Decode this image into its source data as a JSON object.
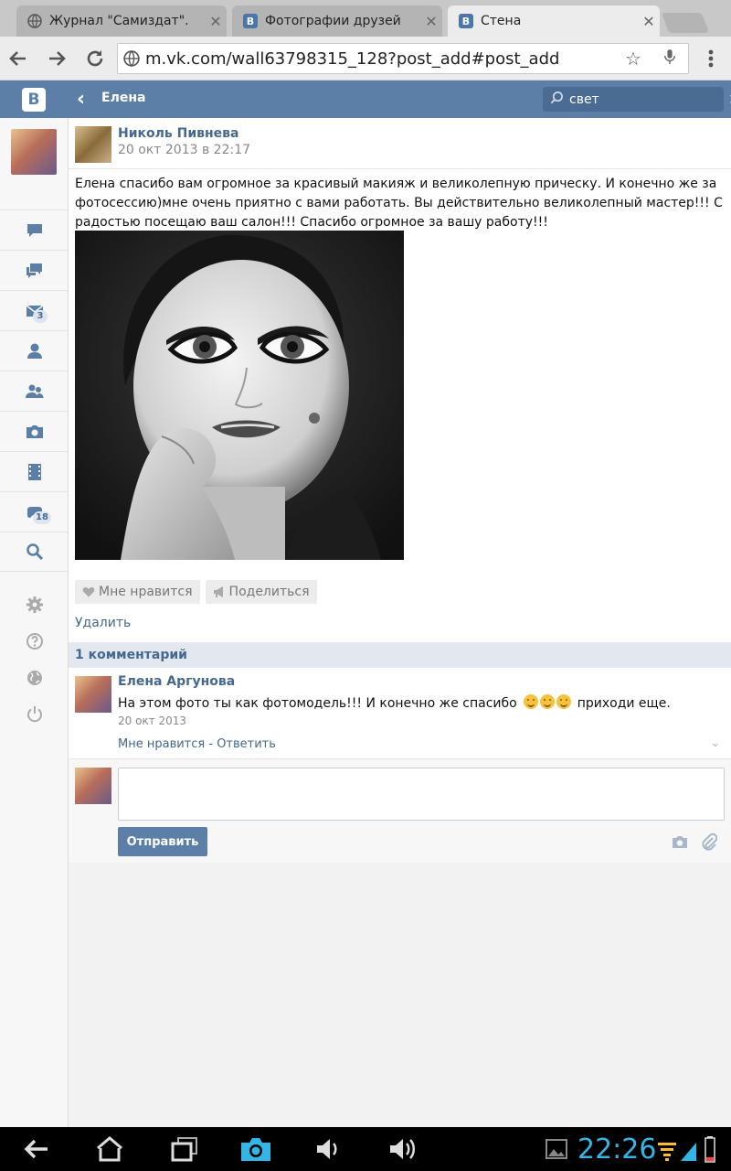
{
  "browser": {
    "tabs": [
      {
        "title": "Журнал \"Самиздат\".",
        "close": "✕",
        "favicon": "globe-icon",
        "active": false
      },
      {
        "title": "Фотографии друзей",
        "close": "✕",
        "favicon": "vk-icon",
        "active": false
      },
      {
        "title": "Стена",
        "close": "✕",
        "favicon": "vk-icon",
        "active": true
      }
    ],
    "url": "m.vk.com/wall63798315_128?post_add#post_add"
  },
  "header": {
    "logo": "B",
    "title": "Елена",
    "search_value": "свет"
  },
  "sidebar": {
    "items": [
      {
        "name": "news-icon"
      },
      {
        "name": "comments-icon"
      },
      {
        "name": "messages-icon",
        "badge": "3"
      },
      {
        "name": "friends-icon"
      },
      {
        "name": "groups-icon"
      },
      {
        "name": "photos-icon"
      },
      {
        "name": "videos-icon"
      },
      {
        "name": "games-icon",
        "badge": "18"
      },
      {
        "name": "search-icon"
      }
    ],
    "subitems": [
      {
        "name": "settings-icon"
      },
      {
        "name": "help-icon"
      },
      {
        "name": "language-icon"
      },
      {
        "name": "logout-icon"
      }
    ]
  },
  "post": {
    "author": "Николь Пивнева",
    "date": "20 окт 2013 в 22:17",
    "text": "Елена спасибо вам огромное за красивый макияж и великолепную прическу. И конечно же за фотосессию)мне очень приятно с вами работать. Вы действительно великолепный мастер!!! С радостью посещаю ваш салон!!! Спасибо огромное за вашу работу!!!",
    "like_label": "Мне нравится",
    "share_label": "Поделиться",
    "delete_label": "Удалить"
  },
  "comments": {
    "count_label": "1 комментарий",
    "items": [
      {
        "author": "Елена Аргунова",
        "text_before": "На этом фото ты как фотомодель!!! И конечно же спасибо",
        "text_after": "приходи еще.",
        "date": "20 окт 2013",
        "like_label": "Мне нравится",
        "separator": " - ",
        "reply_label": "Ответить",
        "more_icon": "⌄"
      }
    ]
  },
  "reply": {
    "send_label": "Отправить"
  },
  "statusbar": {
    "time": "22:26"
  },
  "colors": {
    "vk_blue": "#5b7fa6",
    "link": "#45688e",
    "clock": "#33b5e5"
  }
}
